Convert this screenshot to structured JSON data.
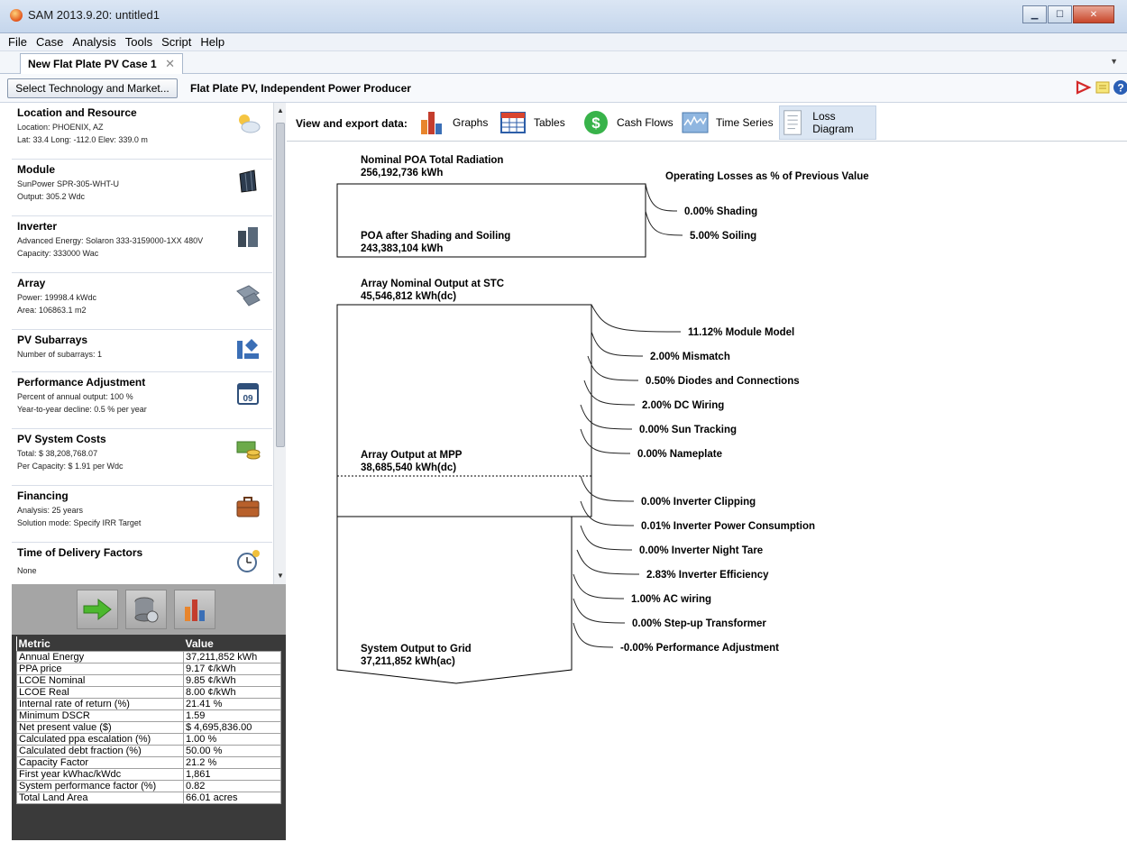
{
  "window": {
    "title": "SAM 2013.9.20: untitled1",
    "controls": {
      "minimize": "▁",
      "maximize": "☐",
      "close": "✕"
    }
  },
  "menu": [
    "File",
    "Case",
    "Analysis",
    "Tools",
    "Script",
    "Help"
  ],
  "tabs": {
    "case_tab": "New Flat Plate PV Case 1",
    "close_glyph": "✕",
    "overflow_glyph": "▼"
  },
  "toolbar": {
    "select_button": "Select Technology and Market...",
    "configuration": "Flat Plate PV, Independent Power Producer",
    "icons": [
      "report-icon",
      "notes-icon",
      "help-icon"
    ]
  },
  "sidebar": {
    "items": [
      {
        "title": "Location and Resource",
        "lines": [
          "Location: PHOENIX, AZ",
          "Lat: 33.4  Long: -112.0  Elev: 339.0 m"
        ],
        "icon": "weather-icon"
      },
      {
        "title": "Module",
        "lines": [
          "SunPower SPR-305-WHT-U",
          "Output: 305.2 Wdc"
        ],
        "icon": "module-icon"
      },
      {
        "title": "Inverter",
        "lines": [
          "Advanced Energy: Solaron 333-3159000-1XX 480V",
          "Capacity: 333000 Wac"
        ],
        "icon": "inverter-icon"
      },
      {
        "title": "Array",
        "lines": [
          "Power: 19998.4 kWdc",
          "Area: 106863.1 m2"
        ],
        "icon": "array-icon"
      },
      {
        "title": "PV Subarrays",
        "lines": [
          "Number of subarrays: 1"
        ],
        "icon": "subarray-icon"
      },
      {
        "title": "Performance Adjustment",
        "lines": [
          "Percent of annual output: 100 %",
          "Year-to-year decline: 0.5 % per year"
        ],
        "icon": "calendar-icon",
        "calendar_day": "09"
      },
      {
        "title": "PV System Costs",
        "lines": [
          "Total: $ 38,208,768.07",
          "Per Capacity: $ 1.91 per Wdc"
        ],
        "icon": "money-icon"
      },
      {
        "title": "Financing",
        "lines": [
          "Analysis: 25 years",
          "Solution mode: Specify IRR Target"
        ],
        "icon": "briefcase-icon"
      },
      {
        "title": "Time of Delivery Factors",
        "lines": [
          "None"
        ],
        "icon": "clock-icon"
      }
    ]
  },
  "actions": [
    "run-simulation-icon",
    "parametrics-icon",
    "results-icon"
  ],
  "metrics": {
    "headers": [
      "Metric",
      "Value"
    ],
    "rows": [
      [
        "Annual Energy",
        "37,211,852 kWh"
      ],
      [
        "PPA price",
        "9.17 ¢/kWh"
      ],
      [
        "LCOE Nominal",
        "9.85 ¢/kWh"
      ],
      [
        "LCOE Real",
        "8.00 ¢/kWh"
      ],
      [
        "Internal rate of return (%)",
        "21.41 %"
      ],
      [
        "Minimum DSCR",
        "1.59"
      ],
      [
        "Net present value ($)",
        "$ 4,695,836.00"
      ],
      [
        "Calculated ppa escalation (%)",
        "1.00 %"
      ],
      [
        "Calculated debt fraction (%)",
        "50.00 %"
      ],
      [
        "Capacity Factor",
        "21.2 %"
      ],
      [
        "First year kWhac/kWdc",
        "1,861"
      ],
      [
        "System performance factor (%)",
        "0.82"
      ],
      [
        "Total Land Area",
        "66.01 acres"
      ]
    ]
  },
  "view": {
    "label": "View and export data:",
    "tabs": [
      {
        "label": "Graphs",
        "icon": "bar-chart-icon"
      },
      {
        "label": "Tables",
        "icon": "table-icon"
      },
      {
        "label": "Cash Flows",
        "icon": "dollar-icon"
      },
      {
        "label": "Time Series",
        "icon": "timeseries-icon"
      },
      {
        "label": "Loss Diagram",
        "icon": "loss-diagram-icon",
        "active": true
      }
    ]
  },
  "loss_diagram": {
    "header": "Operating Losses as % of Previous Value",
    "stages": [
      {
        "title": "Nominal POA Total Radiation",
        "value": "256,192,736 kWh"
      },
      {
        "title": "POA after Shading and Soiling",
        "value": "243,383,104 kWh"
      },
      {
        "title": "Array Nominal Output at STC",
        "value": "45,546,812 kWh(dc)"
      },
      {
        "title": "Array Output at MPP",
        "value": "38,685,540 kWh(dc)"
      },
      {
        "title": "System Output to Grid",
        "value": "37,211,852 kWh(ac)"
      }
    ],
    "losses": [
      {
        "label": "0.00% Shading",
        "value": 0.0
      },
      {
        "label": "5.00% Soiling",
        "value": 5.0
      },
      {
        "label": "11.12% Module Model",
        "value": 11.12
      },
      {
        "label": "2.00% Mismatch",
        "value": 2.0
      },
      {
        "label": "0.50% Diodes and Connections",
        "value": 0.5
      },
      {
        "label": "2.00% DC Wiring",
        "value": 2.0
      },
      {
        "label": "0.00% Sun Tracking",
        "value": 0.0
      },
      {
        "label": "0.00% Nameplate",
        "value": 0.0
      },
      {
        "label": "0.00% Inverter Clipping",
        "value": 0.0
      },
      {
        "label": "0.01% Inverter Power Consumption",
        "value": 0.01
      },
      {
        "label": "0.00% Inverter Night Tare",
        "value": 0.0
      },
      {
        "label": "2.83% Inverter Efficiency",
        "value": 2.83
      },
      {
        "label": "1.00% AC wiring",
        "value": 1.0
      },
      {
        "label": "0.00% Step-up Transformer",
        "value": 0.0
      },
      {
        "label": "-0.00% Performance Adjustment",
        "value": -0.0
      }
    ]
  }
}
